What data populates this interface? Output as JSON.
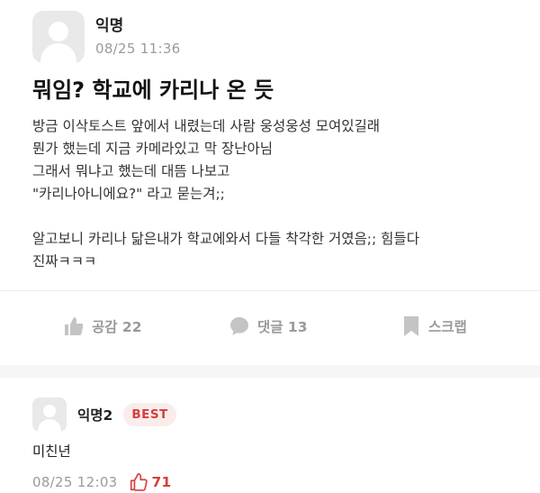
{
  "post": {
    "author": "익명",
    "date": "08/25 11:36",
    "title": "뭐임? 학교에 카리나 온 듯",
    "body_lines": [
      "방금 이삭토스트 앞에서 내렸는데 사람 웅성웅성 모여있길래",
      "뭔가 했는데 지금 카메라있고 막 장난아님",
      "그래서 뭐냐고 했는데 대뜸 나보고",
      "\"카리나아니에요?\" 라고 묻는겨;;",
      "",
      "알고보니 카리나 닮은내가 학교에와서 다들 착각한 거였음;; 힘들다",
      "진짜ㅋㅋㅋ"
    ]
  },
  "actions": {
    "like_label": "공감 22",
    "comment_label": "댓글 13",
    "scrap_label": "스크랩"
  },
  "comment": {
    "author": "익명2",
    "badge": "BEST",
    "text": "미친년",
    "date": "08/25 12:03",
    "likes": "71"
  },
  "colors": {
    "accent": "#d3403c",
    "muted": "#9b9b9b",
    "avatar_bg": "#e9e9e9"
  },
  "icons": {
    "like": "thumbs-up-icon",
    "comment": "speech-bubble-icon",
    "scrap": "bookmark-icon",
    "comment_like": "thumbs-up-outline-icon"
  }
}
